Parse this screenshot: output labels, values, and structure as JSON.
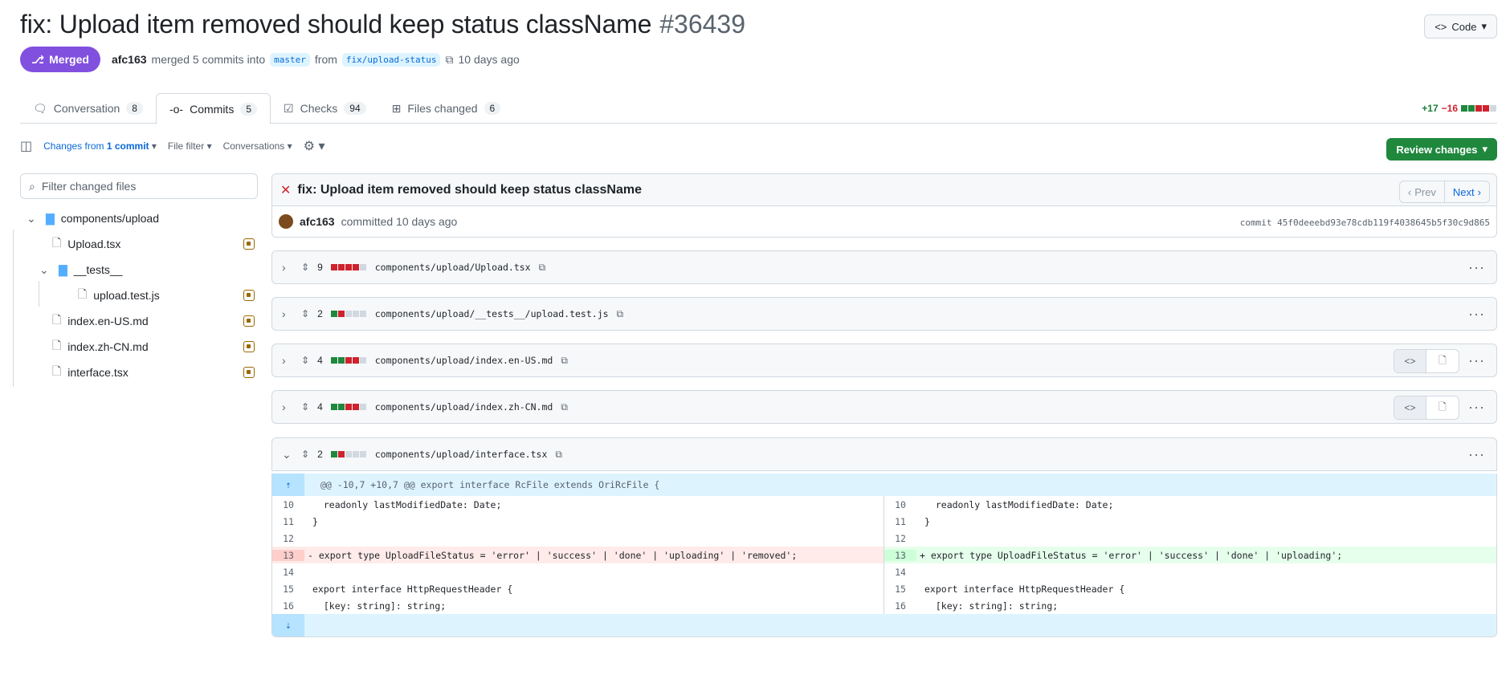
{
  "pr": {
    "title": "fix: Upload item removed should keep status className",
    "number": "#36439",
    "state": "Merged",
    "author": "afc163",
    "merge_text": "merged 5 commits into",
    "base_branch": "master",
    "from_text": "from",
    "head_branch": "fix/upload-status",
    "time": "10 days ago",
    "code_button": "Code"
  },
  "tabs": [
    {
      "label": "Conversation",
      "count": "8"
    },
    {
      "label": "Commits",
      "count": "5"
    },
    {
      "label": "Checks",
      "count": "94"
    },
    {
      "label": "Files changed",
      "count": "6"
    }
  ],
  "diffstat": {
    "additions": "+17",
    "deletions": "−16"
  },
  "toolbar": {
    "changes_prefix": "Changes from",
    "changes_value": "1 commit",
    "file_filter": "File filter",
    "conversations": "Conversations",
    "review_button": "Review changes"
  },
  "filter_placeholder": "Filter changed files",
  "tree": {
    "folder1": "components/upload",
    "file1": "Upload.tsx",
    "folder2": "__tests__",
    "file2": "upload.test.js",
    "file3": "index.en-US.md",
    "file4": "index.zh-CN.md",
    "file5": "interface.tsx"
  },
  "commit": {
    "title": "fix: Upload item removed should keep status className",
    "prev": "Prev",
    "next": "Next",
    "author": "afc163",
    "committed": "committed 10 days ago",
    "sha": "commit 45f0deeebd93e78cdb119f4038645b5f30c9d865"
  },
  "files": [
    {
      "changes": "9",
      "path": "components/upload/Upload.tsx"
    },
    {
      "changes": "2",
      "path": "components/upload/__tests__/upload.test.js"
    },
    {
      "changes": "4",
      "path": "components/upload/index.en-US.md"
    },
    {
      "changes": "4",
      "path": "components/upload/index.zh-CN.md"
    },
    {
      "changes": "2",
      "path": "components/upload/interface.tsx"
    }
  ],
  "diff": {
    "hunk": "@@ -10,7 +10,7 @@ export interface RcFile extends OriRcFile {",
    "left": [
      {
        "n": "10",
        "text": "  readonly lastModifiedDate: Date;"
      },
      {
        "n": "11",
        "text": "}"
      },
      {
        "n": "12",
        "text": ""
      },
      {
        "n": "13",
        "text": "- export type UploadFileStatus = 'error' | 'success' | 'done' | 'uploading' | 'removed';"
      },
      {
        "n": "14",
        "text": ""
      },
      {
        "n": "15",
        "text": "export interface HttpRequestHeader {"
      },
      {
        "n": "16",
        "text": "  [key: string]: string;"
      }
    ],
    "right": [
      {
        "n": "10",
        "text": "  readonly lastModifiedDate: Date;"
      },
      {
        "n": "11",
        "text": "}"
      },
      {
        "n": "12",
        "text": ""
      },
      {
        "n": "13",
        "text": "+ export type UploadFileStatus = 'error' | 'success' | 'done' | 'uploading';"
      },
      {
        "n": "14",
        "text": ""
      },
      {
        "n": "15",
        "text": "export interface HttpRequestHeader {"
      },
      {
        "n": "16",
        "text": "  [key: string]: string;"
      }
    ]
  },
  "colors": {
    "merged": "#8250df",
    "review": "#1f883d",
    "link": "#0969da"
  }
}
